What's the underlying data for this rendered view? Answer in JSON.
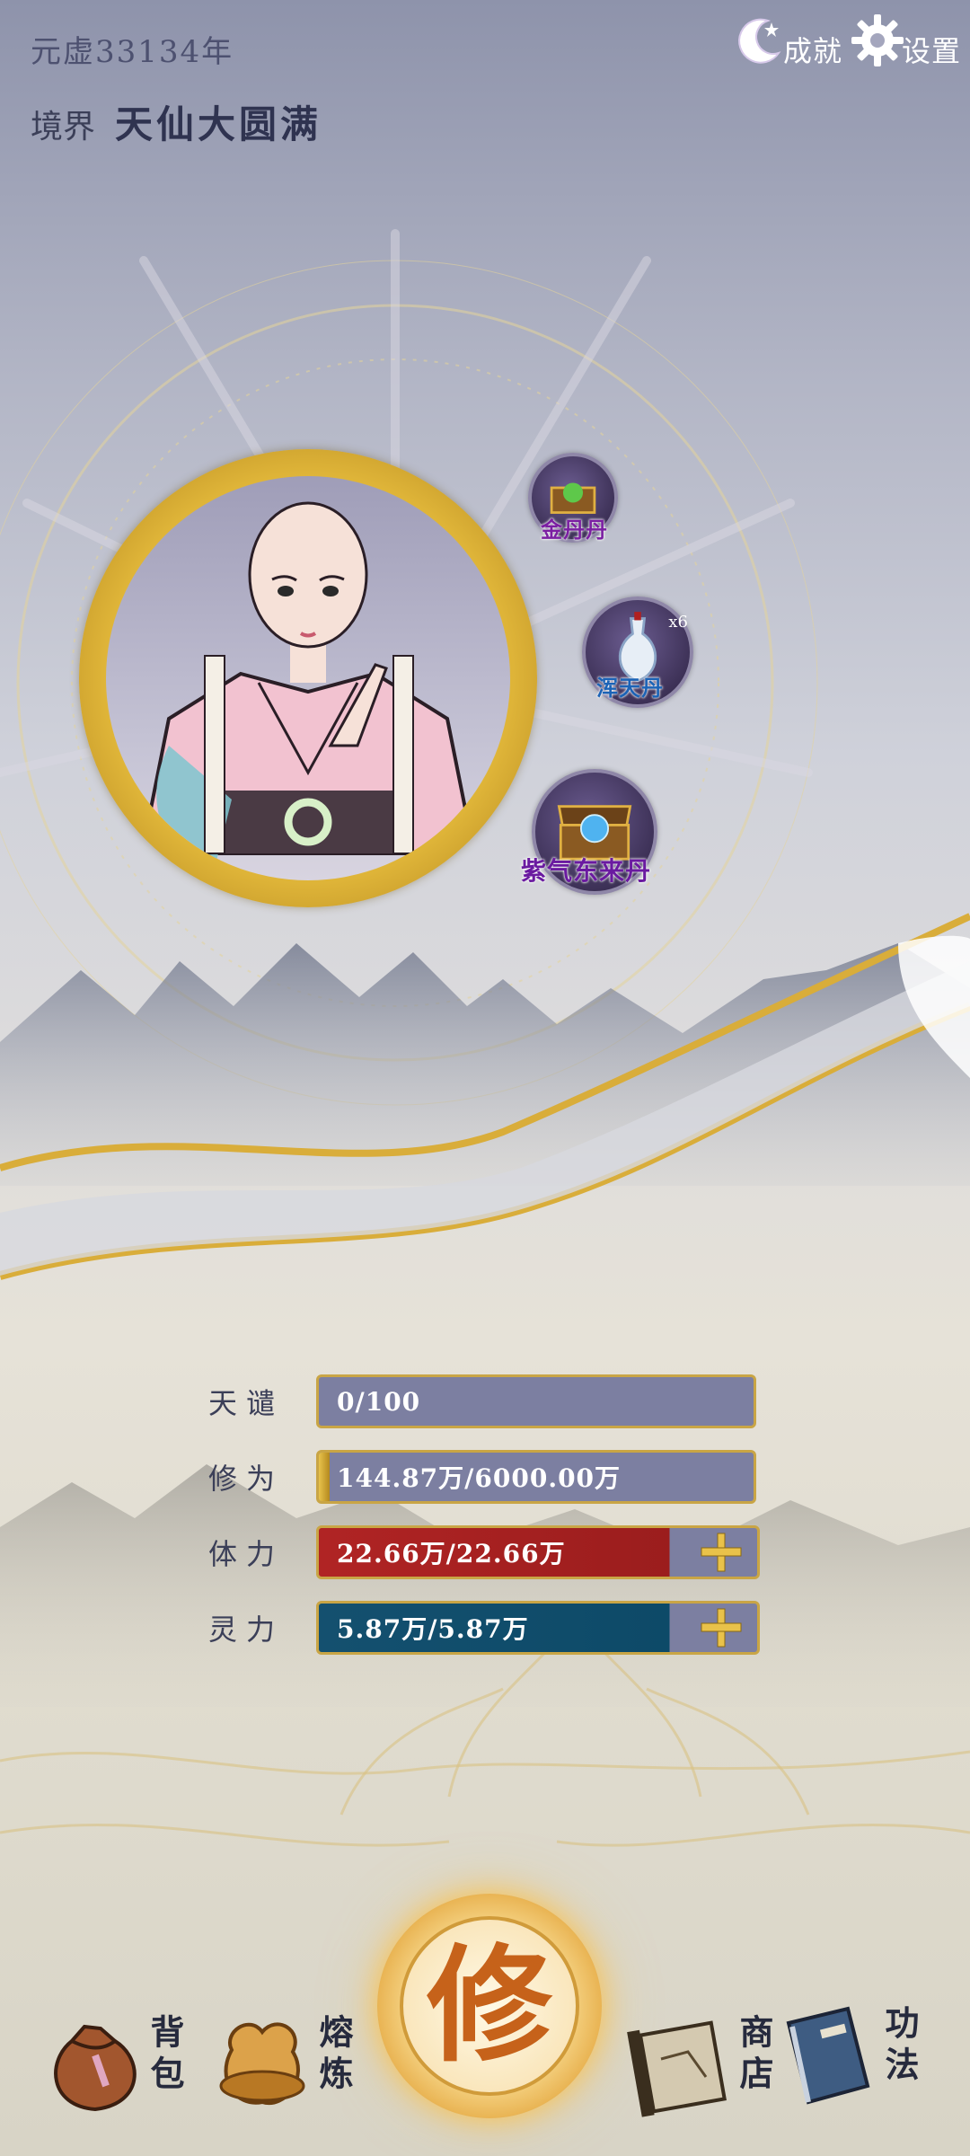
{
  "header": {
    "era": "元虚33134年",
    "realm_label": "境界",
    "realm_value": "天仙大圆满"
  },
  "top_buttons": {
    "achievements": "成就",
    "settings": "设置"
  },
  "pills": [
    {
      "name": "金丹丹",
      "quantity": ""
    },
    {
      "name": "浑天丹",
      "quantity": "x6"
    },
    {
      "name": "紫气东来丹",
      "quantity": ""
    }
  ],
  "stats": [
    {
      "label": "天谴",
      "value": "0/100",
      "fill": 0.0
    },
    {
      "label": "修为",
      "value": "144.87万/6000.00万",
      "fill": 0.024
    },
    {
      "label": "体力",
      "value": "22.66万/22.66万",
      "fill": 1.0
    },
    {
      "label": "灵力",
      "value": "5.87万/5.87万",
      "fill": 1.0
    }
  ],
  "cultivate_label": "修",
  "nav": {
    "bag": "背包",
    "forge": "熔炼",
    "shop": "商店",
    "skills": "功法"
  },
  "colors": {
    "gold": "#c9a545",
    "slate": "#7c7fa1",
    "hp_red": "#b02424",
    "mana_blue": "#14506f",
    "cultivate_orange": "#c6621a"
  },
  "icons": {
    "achievements": "moon-star-icon",
    "settings": "gear-icon",
    "plus": "plus-icon",
    "bag": "pouch-icon",
    "forge": "furnace-icon",
    "shop": "scroll-map-icon",
    "skills": "book-icon"
  }
}
